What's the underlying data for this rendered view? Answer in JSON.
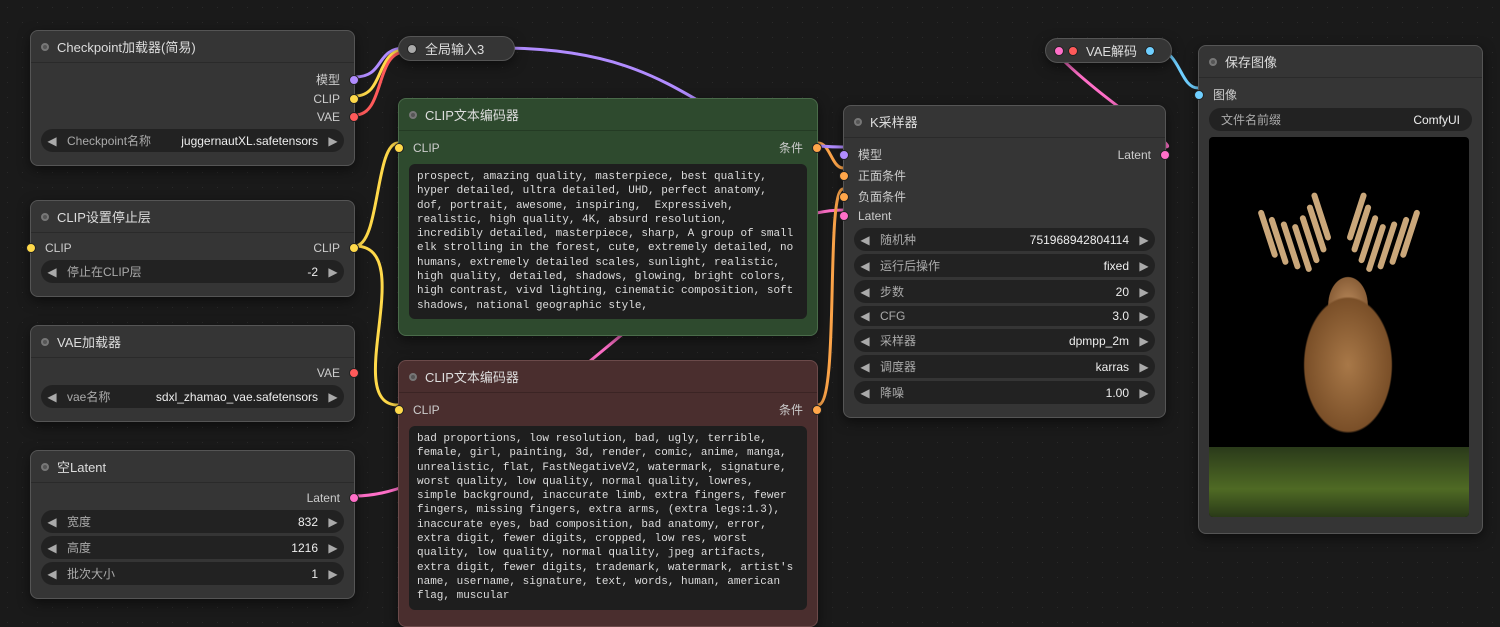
{
  "nodes": {
    "checkpoint_loader": {
      "title": "Checkpoint加载器(简易)",
      "outputs": {
        "model": "模型",
        "clip": "CLIP",
        "vae": "VAE"
      },
      "widget": {
        "label": "Checkpoint名称",
        "value": "juggernautXL.safetensors"
      }
    },
    "clip_stop": {
      "title": "CLIP设置停止层",
      "input": "CLIP",
      "output": "CLIP",
      "widget": {
        "label": "停止在CLIP层",
        "value": "-2"
      }
    },
    "vae_loader": {
      "title": "VAE加载器",
      "output": "VAE",
      "widget": {
        "label": "vae名称",
        "value": "sdxl_zhamao_vae.safetensors"
      }
    },
    "empty_latent": {
      "title": "空Latent",
      "output": "Latent",
      "widgets": [
        {
          "label": "宽度",
          "value": "832"
        },
        {
          "label": "高度",
          "value": "1216"
        },
        {
          "label": "批次大小",
          "value": "1"
        }
      ]
    },
    "global_in": {
      "title": "全局输入3"
    },
    "clip_pos": {
      "title": "CLIP文本编码器",
      "input": "CLIP",
      "output": "条件",
      "text": "prospect, amazing quality, masterpiece, best quality, hyper detailed, ultra detailed, UHD, perfect anatomy, dof, portrait, awesome, inspiring,  Expressiveh, realistic, high quality, 4K, absurd resolution, incredibly detailed, masterpiece, sharp, A group of small elk strolling in the forest, cute, extremely detailed, no humans, extremely detailed scales, sunlight, realistic, high quality, detailed, shadows, glowing, bright colors, high contrast, vivd lighting, cinematic composition, soft shadows, national geographic style,"
    },
    "clip_neg": {
      "title": "CLIP文本编码器",
      "input": "CLIP",
      "output": "条件",
      "text": "bad proportions, low resolution, bad, ugly, terrible, female, girl, painting, 3d, render, comic, anime, manga, unrealistic, flat, FastNegativeV2, watermark, signature, worst quality, low quality, normal quality, lowres, simple background, inaccurate limb, extra fingers, fewer fingers, missing fingers, extra arms, (extra legs:1.3), inaccurate eyes, bad composition, bad anatomy, error, extra digit, fewer digits, cropped, low res, worst quality, low quality, normal quality, jpeg artifacts, extra digit, fewer digits, trademark, watermark, artist's name, username, signature, text, words, human, american flag, muscular"
    },
    "ksampler": {
      "title": "K采样器",
      "inputs": {
        "model": "模型",
        "positive": "正面条件",
        "negative": "负面条件",
        "latent": "Latent"
      },
      "output": "Latent",
      "widgets": [
        {
          "label": "随机种",
          "value": "751968942804114"
        },
        {
          "label": "运行后操作",
          "value": "fixed"
        },
        {
          "label": "步数",
          "value": "20"
        },
        {
          "label": "CFG",
          "value": "3.0"
        },
        {
          "label": "采样器",
          "value": "dpmpp_2m"
        },
        {
          "label": "调度器",
          "value": "karras"
        },
        {
          "label": "降噪",
          "value": "1.00"
        }
      ]
    },
    "vae_decode": {
      "title": "VAE解码"
    },
    "save_image": {
      "title": "保存图像",
      "input": "图像",
      "widget": {
        "label": "文件名前缀",
        "value": "ComfyUI"
      }
    }
  }
}
